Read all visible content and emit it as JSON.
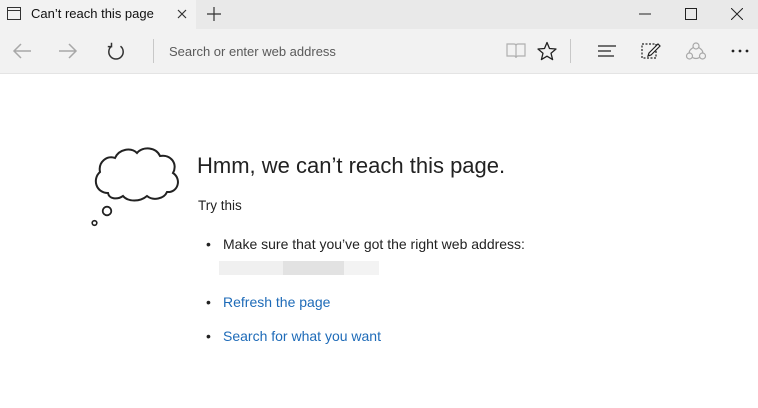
{
  "tab": {
    "title": "Can’t reach this page",
    "icon": "page-icon",
    "close_icon": "close-icon",
    "new_tab_icon": "plus-icon"
  },
  "window_controls": [
    "minimize-icon",
    "maximize-icon",
    "close-icon"
  ],
  "nav": {
    "back_icon": "back-arrow-icon",
    "forward_icon": "forward-arrow-icon",
    "refresh_icon": "refresh-icon",
    "address_placeholder": "Search or enter web address",
    "tools": [
      "reading-view-icon",
      "favorite-star-icon",
      "hub-icon",
      "web-note-icon",
      "share-icon",
      "more-icon"
    ]
  },
  "error": {
    "heading": "Hmm, we can’t reach this page.",
    "try_this": "Try this",
    "tips": [
      {
        "text": "Make sure that you’ve got the right web address:",
        "link": false
      },
      {
        "text": "Refresh the page",
        "link": true
      },
      {
        "text": "Search for what you want",
        "link": true
      }
    ],
    "bullet": "•"
  },
  "colors": {
    "link": "#1e6bb8",
    "chrome": "#f2f2f2",
    "titlebar": "#e9e9e9"
  }
}
